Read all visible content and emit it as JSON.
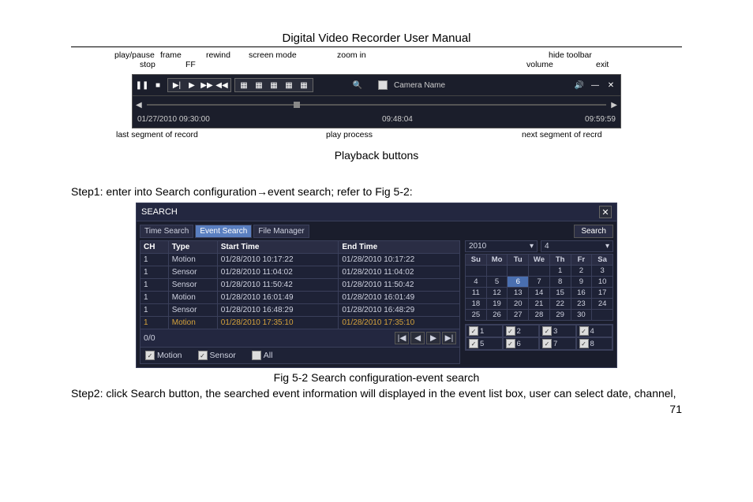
{
  "header": {
    "title": "Digital Video Recorder User Manual"
  },
  "playback": {
    "labels": {
      "play_pause": "play/pause",
      "frame": "frame",
      "ff": "FF",
      "rewind": "rewind",
      "stop": "stop",
      "screen_mode": "screen mode",
      "zoom_in": "zoom in",
      "hide_toolbar": "hide toolbar",
      "volume": "volume",
      "exit": "exit",
      "last_segment": "last segment of record",
      "play_process": "play process",
      "next_segment": "next segment of recrd"
    },
    "camera_name": "Camera Name",
    "time_start": "01/27/2010  09:30:00",
    "time_mid": "09:48:04",
    "time_end": "09:59:59",
    "caption": "Playback buttons"
  },
  "step1": "Step1: enter into Search configuration→event search; refer to Fig 5-2:",
  "search": {
    "title": "SEARCH",
    "tabs": [
      "Time Search",
      "Event Search",
      "File Manager"
    ],
    "search_btn": "Search",
    "headers": [
      "CH",
      "Type",
      "Start Time",
      "End Time"
    ],
    "rows": [
      {
        "ch": "1",
        "type": "Motion",
        "start": "01/28/2010 10:17:22",
        "end": "01/28/2010 10:17:22",
        "hl": false
      },
      {
        "ch": "1",
        "type": "Sensor",
        "start": "01/28/2010 11:04:02",
        "end": "01/28/2010 11:04:02",
        "hl": false
      },
      {
        "ch": "1",
        "type": "Sensor",
        "start": "01/28/2010 11:50:42",
        "end": "01/28/2010 11:50:42",
        "hl": false
      },
      {
        "ch": "1",
        "type": "Motion",
        "start": "01/28/2010 16:01:49",
        "end": "01/28/2010 16:01:49",
        "hl": false
      },
      {
        "ch": "1",
        "type": "Sensor",
        "start": "01/28/2010 16:48:29",
        "end": "01/28/2010 16:48:29",
        "hl": false
      },
      {
        "ch": "1",
        "type": "Motion",
        "start": "01/28/2010 17:35:10",
        "end": "01/28/2010 17:35:10",
        "hl": true
      }
    ],
    "pager": "0/0",
    "filters": {
      "motion": "Motion",
      "sensor": "Sensor",
      "all": "All"
    },
    "year": "2010",
    "month": "4",
    "dow": [
      "Su",
      "Mo",
      "Tu",
      "We",
      "Th",
      "Fr",
      "Sa"
    ],
    "weeks": [
      [
        "",
        "",
        "",
        "",
        "1",
        "2",
        "3"
      ],
      [
        "4",
        "5",
        "6",
        "7",
        "8",
        "9",
        "10"
      ],
      [
        "11",
        "12",
        "13",
        "14",
        "15",
        "16",
        "17"
      ],
      [
        "18",
        "19",
        "20",
        "21",
        "22",
        "23",
        "24"
      ],
      [
        "25",
        "26",
        "27",
        "28",
        "29",
        "30",
        ""
      ]
    ],
    "today": "6",
    "channels": [
      "1",
      "2",
      "3",
      "4",
      "5",
      "6",
      "7",
      "8"
    ]
  },
  "fig_caption": "Fig 5-2 Search configuration-event search",
  "step2": "Step2: click Search button, the searched event information will displayed in the event list box, user can select date, channel,",
  "page_num": "71"
}
